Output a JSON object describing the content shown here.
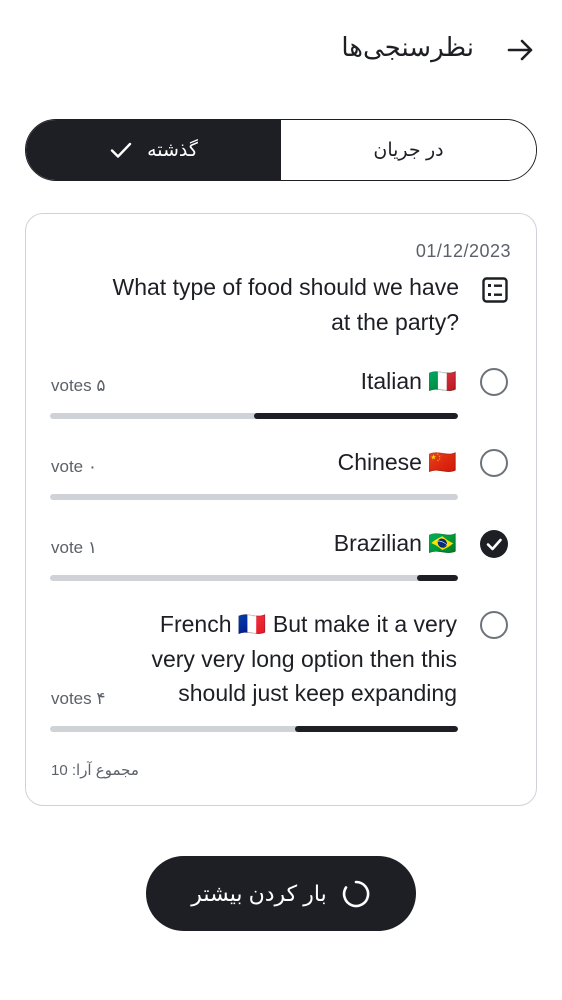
{
  "header": {
    "title": "نظرسنجی‌ها",
    "back_icon": "arrow-right-icon"
  },
  "tabs": [
    {
      "label": "گذشته",
      "active": true
    },
    {
      "label": "در جریان",
      "active": false
    }
  ],
  "poll": {
    "date": "01/12/2023",
    "question_line1": "What type of food should we have",
    "question_line2": "?at the party",
    "options": [
      {
        "label": "Italian 🇮🇹",
        "votes": "votes ۵",
        "selected": false,
        "share": 0.5
      },
      {
        "label": "Chinese 🇨🇳",
        "votes": "vote ۰",
        "selected": false,
        "share": 0
      },
      {
        "label": "Brazilian 🇧🇷",
        "votes": "vote ۱",
        "selected": true,
        "share": 0.1
      },
      {
        "label_line1": "French 🇫🇷 But make it a very",
        "label_line2": "very very long option then this",
        "label_line3": "should just keep expanding",
        "votes": "votes ۴",
        "selected": false,
        "share": 0.4
      }
    ],
    "total": "مجموع آرا: 10"
  },
  "load_more": {
    "label": "بار کردن بیشتر"
  },
  "colors": {
    "dark": "#1d1f24",
    "track": "#cfd3d8",
    "muted": "#5c6169"
  }
}
